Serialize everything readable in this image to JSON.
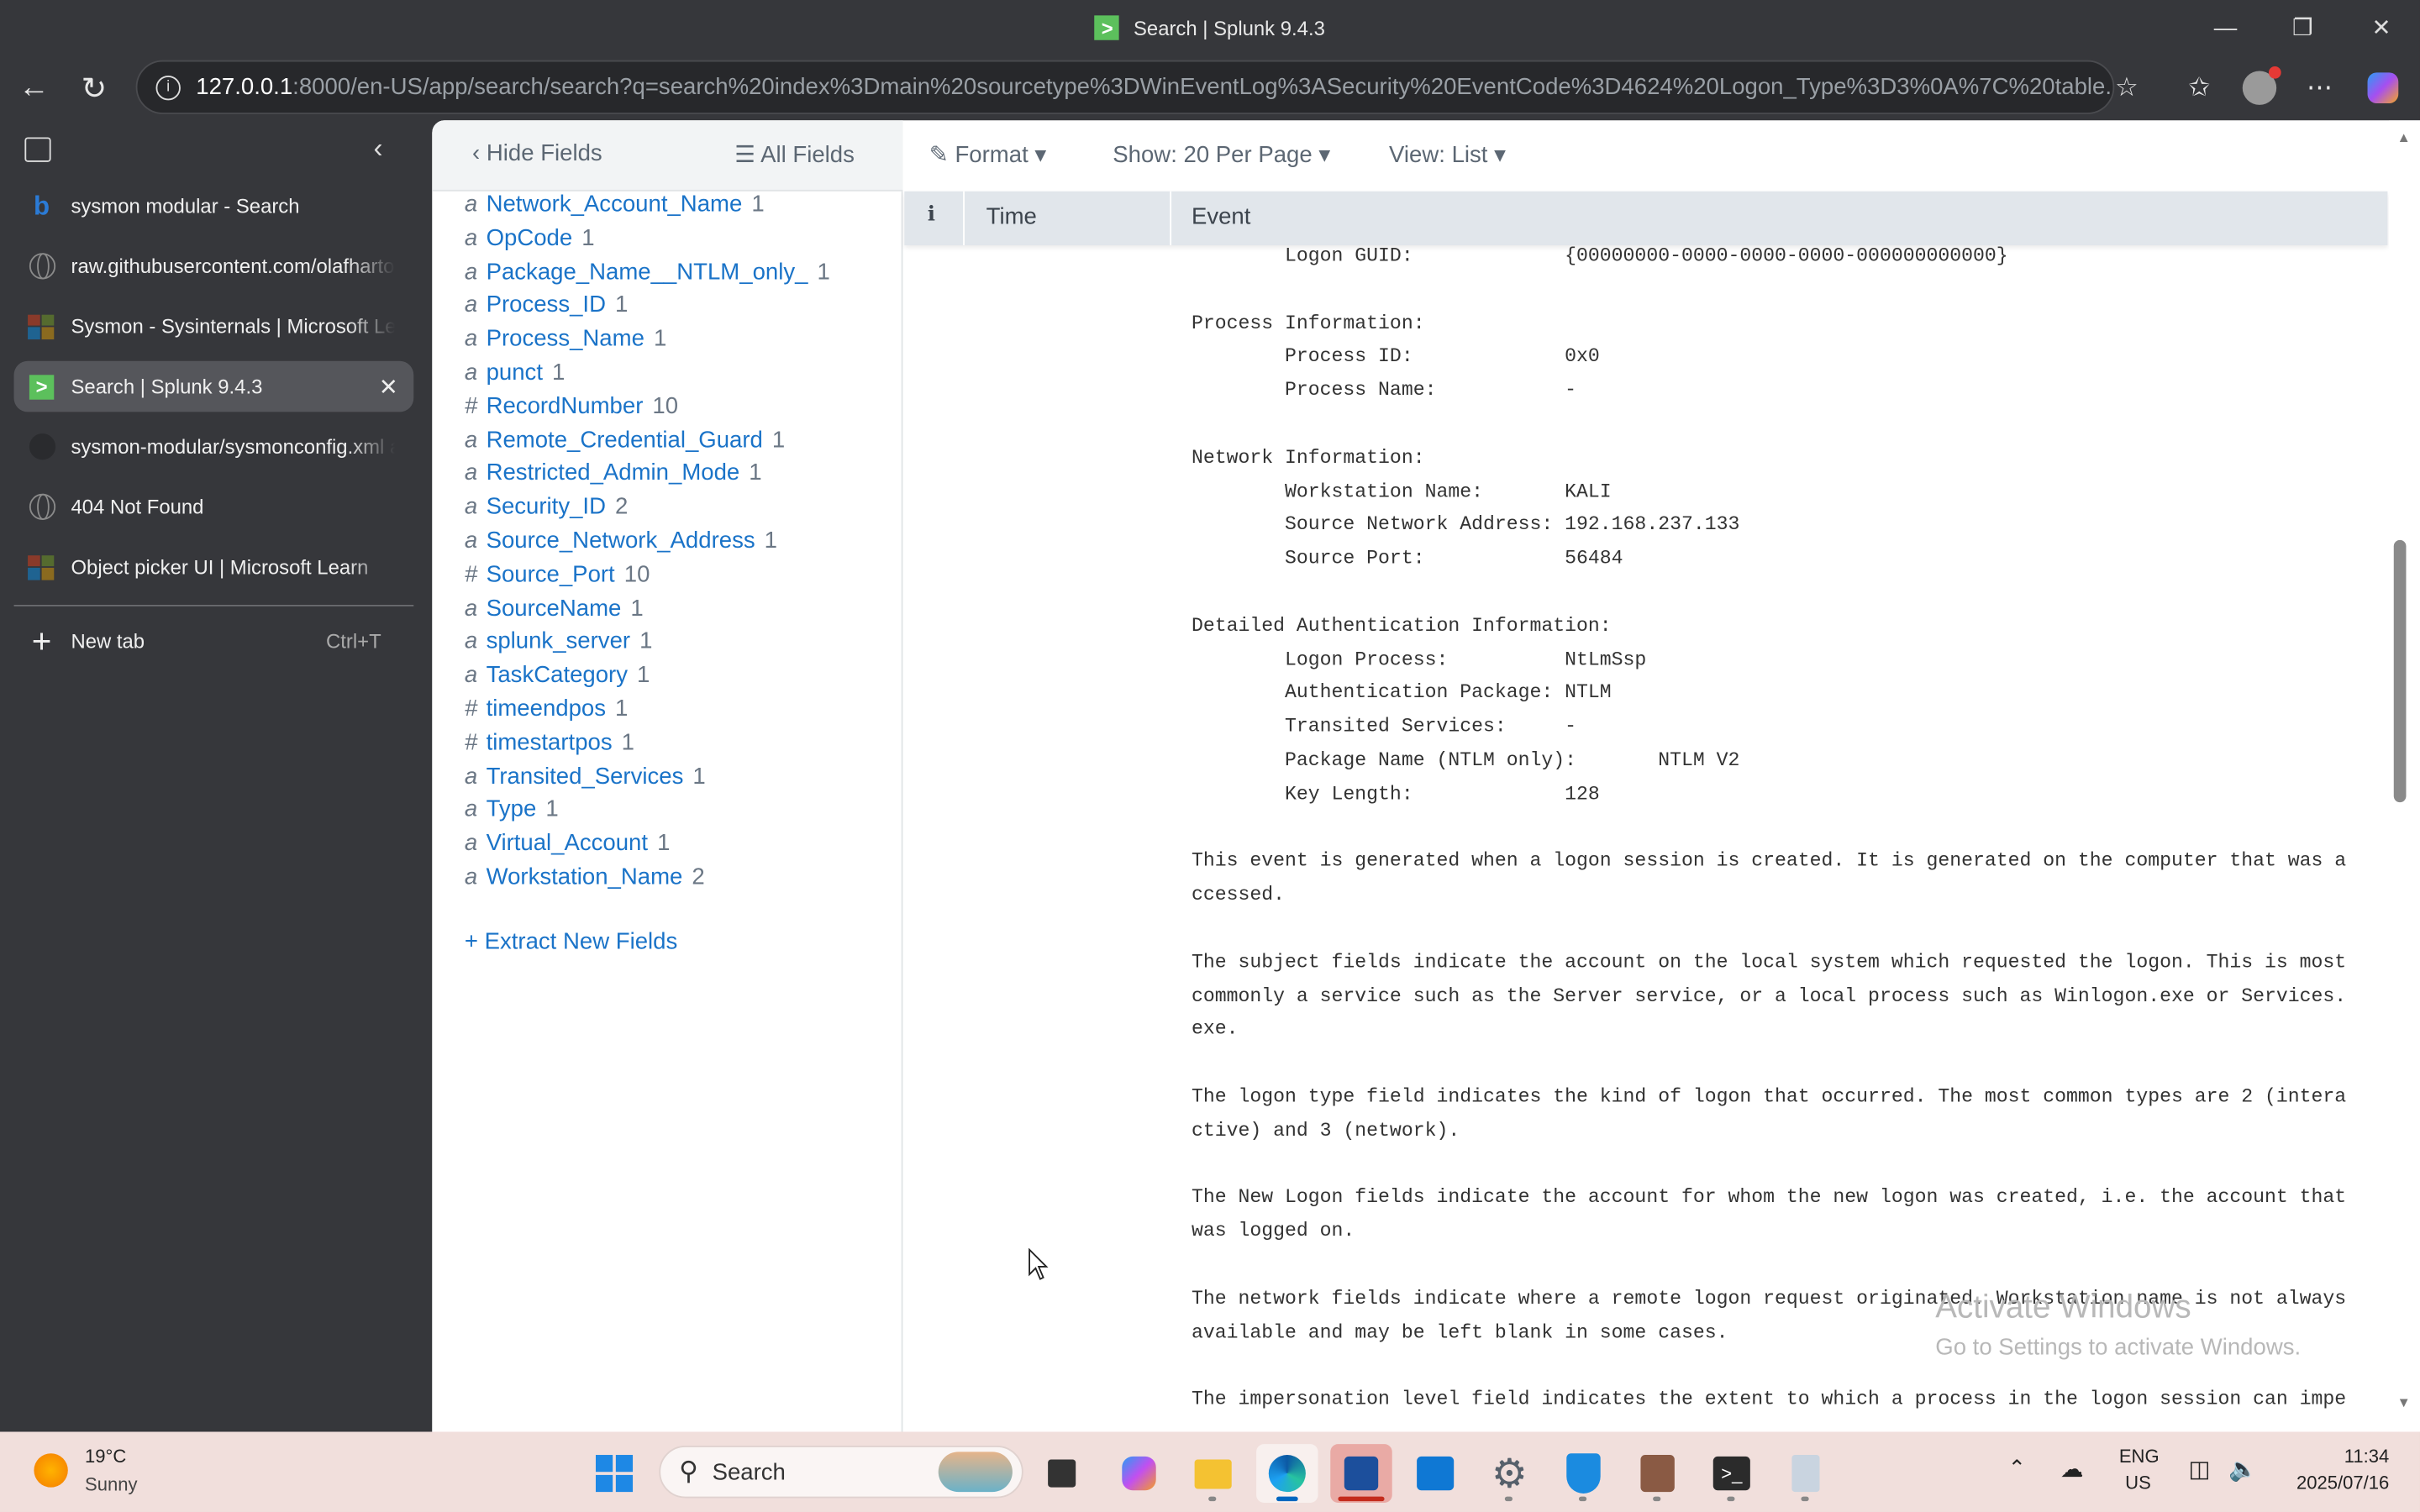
{
  "window": {
    "title": "Search | Splunk 9.4.3"
  },
  "address_bar": {
    "host": "127.0.0.1",
    "rest": ":8000/en-US/app/search/search?q=search%20index%3Dmain%20sourcetype%3DWinEventLog%3ASecurity%20EventCode%3D4624%20Logon_Type%3D3%0A%7C%20table..."
  },
  "tabs": [
    {
      "title": "sysmon modular - Search",
      "icon": "bing-icon"
    },
    {
      "title": "raw.githubusercontent.com/olafhartong",
      "icon": "globe-icon"
    },
    {
      "title": "Sysmon - Sysinternals | Microsoft Learn",
      "icon": "microsoft-icon"
    },
    {
      "title": "Search | Splunk 9.4.3",
      "icon": "splunk-icon",
      "active": true
    },
    {
      "title": "sysmon-modular/sysmonconfig.xml at master",
      "icon": "github-icon"
    },
    {
      "title": "404 Not Found",
      "icon": "globe-icon"
    },
    {
      "title": "Object picker UI | Microsoft Learn",
      "icon": "microsoft-icon"
    }
  ],
  "new_tab": {
    "label": "New tab",
    "shortcut": "Ctrl+T"
  },
  "fields_panel": {
    "hide_fields": "Hide Fields",
    "all_fields": "All Fields",
    "extract": "+ Extract New Fields",
    "fields": [
      {
        "type": "a",
        "name": "Network_Account_Name",
        "count": "1"
      },
      {
        "type": "a",
        "name": "OpCode",
        "count": "1"
      },
      {
        "type": "a",
        "name": "Package_Name__NTLM_only_",
        "count": "1"
      },
      {
        "type": "a",
        "name": "Process_ID",
        "count": "1"
      },
      {
        "type": "a",
        "name": "Process_Name",
        "count": "1"
      },
      {
        "type": "a",
        "name": "punct",
        "count": "1"
      },
      {
        "type": "#",
        "name": "RecordNumber",
        "count": "10"
      },
      {
        "type": "a",
        "name": "Remote_Credential_Guard",
        "count": "1"
      },
      {
        "type": "a",
        "name": "Restricted_Admin_Mode",
        "count": "1"
      },
      {
        "type": "a",
        "name": "Security_ID",
        "count": "2"
      },
      {
        "type": "a",
        "name": "Source_Network_Address",
        "count": "1"
      },
      {
        "type": "#",
        "name": "Source_Port",
        "count": "10"
      },
      {
        "type": "a",
        "name": "SourceName",
        "count": "1"
      },
      {
        "type": "a",
        "name": "splunk_server",
        "count": "1"
      },
      {
        "type": "a",
        "name": "TaskCategory",
        "count": "1"
      },
      {
        "type": "#",
        "name": "timeendpos",
        "count": "1"
      },
      {
        "type": "#",
        "name": "timestartpos",
        "count": "1"
      },
      {
        "type": "a",
        "name": "Transited_Services",
        "count": "1"
      },
      {
        "type": "a",
        "name": "Type",
        "count": "1"
      },
      {
        "type": "a",
        "name": "Virtual_Account",
        "count": "1"
      },
      {
        "type": "a",
        "name": "Workstation_Name",
        "count": "2"
      }
    ]
  },
  "results_toolbar": {
    "format": "Format",
    "show": "Show: 20 Per Page",
    "view": "View: List"
  },
  "table_header": {
    "info": "i",
    "time": "Time",
    "event": "Event"
  },
  "event_lines": [
    "        Logon GUID:             {00000000-0000-0000-0000-000000000000}",
    "",
    "Process Information:",
    "        Process ID:             0x0",
    "        Process Name:           -",
    "",
    "Network Information:",
    "        Workstation Name:       KALI",
    "        Source Network Address: 192.168.237.133",
    "        Source Port:            56484",
    "",
    "Detailed Authentication Information:",
    "        Logon Process:          NtLmSsp",
    "        Authentication Package: NTLM",
    "        Transited Services:     -",
    "        Package Name (NTLM only):       NTLM V2",
    "        Key Length:             128",
    "",
    "This event is generated when a logon session is created. It is generated on the computer that was a",
    "ccessed.",
    "",
    "The subject fields indicate the account on the local system which requested the logon. This is most",
    "commonly a service such as the Server service, or a local process such as Winlogon.exe or Services.",
    "exe.",
    "",
    "The logon type field indicates the kind of logon that occurred. The most common types are 2 (intera",
    "ctive) and 3 (network).",
    "",
    "The New Logon fields indicate the account for whom the new logon was created, i.e. the account that",
    "was logged on.",
    "",
    "The network fields indicate where a remote logon request originated. Workstation name is not always",
    "available and may be left blank in some cases.",
    "",
    "The impersonation level field indicates the extent to which a process in the logon session can impe"
  ],
  "watermark": {
    "line1": "Activate Windows",
    "line2": "Go to Settings to activate Windows."
  },
  "taskbar": {
    "weather_temp": "19°C",
    "weather_desc": "Sunny",
    "search": "Search",
    "lang1": "ENG",
    "lang2": "US",
    "time": "11:34",
    "date": "2025/07/16"
  }
}
